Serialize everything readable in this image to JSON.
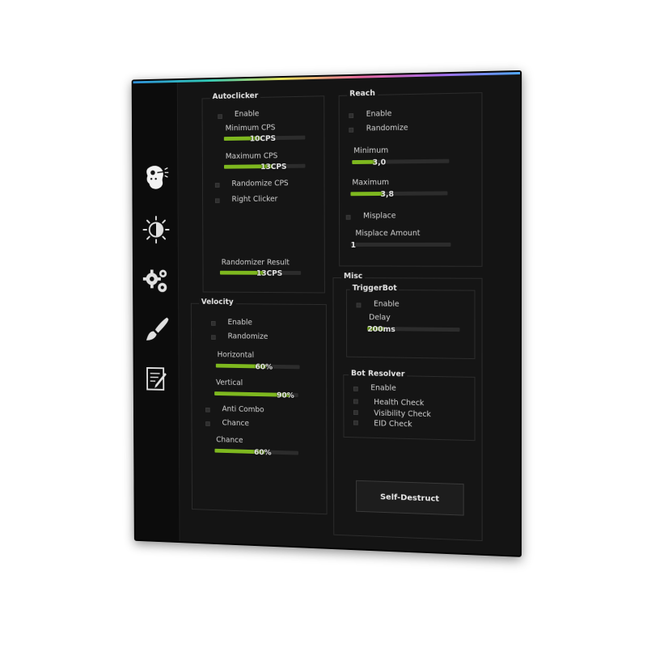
{
  "accent": "#7eb81f",
  "sidebar": {
    "icons": [
      "face-icon",
      "brightness-icon",
      "gears-icon",
      "brush-icon",
      "notepad-icon"
    ]
  },
  "autoclicker": {
    "title": "Autoclicker",
    "enable_label": "Enable",
    "min_cps_label": "Minimum CPS",
    "min_cps_value": "10CPS",
    "min_cps_fraction": 0.45,
    "max_cps_label": "Maximum CPS",
    "max_cps_value": "13CPS",
    "max_cps_fraction": 0.6,
    "randomize_cps_label": "Randomize CPS",
    "right_clicker_label": "Right Clicker",
    "randomizer_result_label": "Randomizer Result",
    "randomizer_result_value": "13CPS",
    "randomizer_result_fraction": 0.55
  },
  "velocity": {
    "title": "Velocity",
    "enable_label": "Enable",
    "randomize_label": "Randomize",
    "horizontal_label": "Horizontal",
    "horizontal_value": "60%",
    "horizontal_fraction": 0.6,
    "vertical_label": "Vertical",
    "vertical_value": "90%",
    "vertical_fraction": 0.9,
    "anti_combo_label": "Anti Combo",
    "chance_check_label": "Chance",
    "chance_label": "Chance",
    "chance_value": "60%",
    "chance_fraction": 0.6
  },
  "reach": {
    "title": "Reach",
    "enable_label": "Enable",
    "randomize_label": "Randomize",
    "minimum_label": "Minimum",
    "minimum_value": "3,0",
    "minimum_fraction": 0.25,
    "maximum_label": "Maximum",
    "maximum_value": "3,8",
    "maximum_fraction": 0.35,
    "misplace_label": "Misplace",
    "misplace_amount_label": "Misplace Amount",
    "misplace_amount_value": "1",
    "misplace_amount_fraction": 0.0
  },
  "misc": {
    "title": "Misc",
    "triggerbot": {
      "title": "TriggerBot",
      "enable_label": "Enable",
      "delay_label": "Delay",
      "delay_value": "200ms",
      "delay_fraction": 0.18
    },
    "bot_resolver": {
      "title": "Bot Resolver",
      "enable_label": "Enable",
      "health_check_label": "Health Check",
      "visibility_check_label": "Visibility Check",
      "eid_check_label": "EID Check"
    },
    "self_destruct_label": "Self-Destruct"
  }
}
